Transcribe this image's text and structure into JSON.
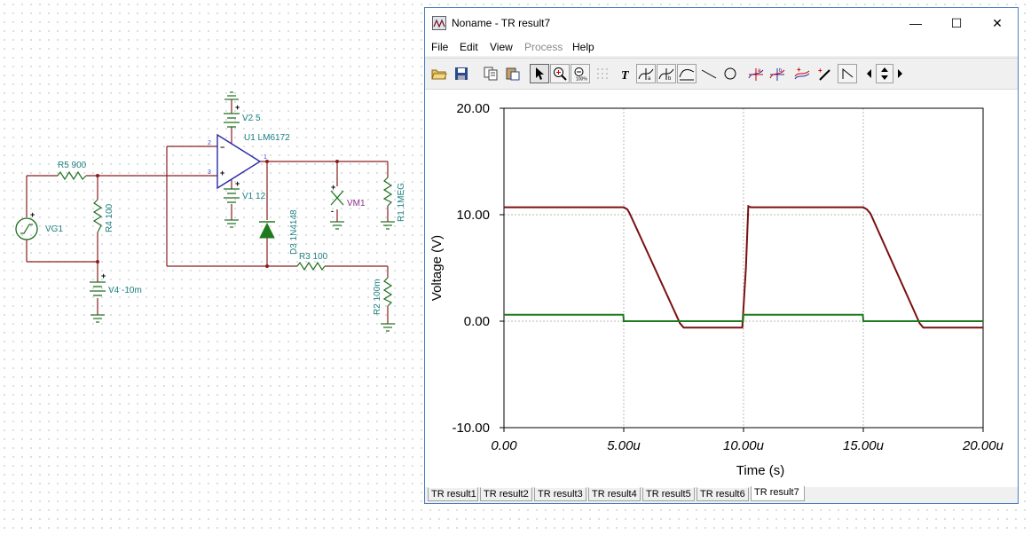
{
  "schematic": {
    "labels": {
      "r5": "R5 900",
      "r4": "R4 100",
      "vg1": "VG1",
      "v4": "V4 -10m",
      "v2": "V2 5",
      "v1": "V1 12",
      "u1": "U1 LM6172",
      "d3": "D3 1N4148",
      "r3": "R3 100",
      "vm1": "VM1",
      "r1": "R1 1MEG",
      "r2": "R2 100m"
    },
    "pins": {
      "p2": "2",
      "p3": "3",
      "p1": "1"
    }
  },
  "window": {
    "title": "Noname - TR result7",
    "controls": {
      "minimize": "—",
      "maximize": "☐",
      "close": "✕"
    },
    "menu": [
      {
        "label": "File",
        "enabled": true
      },
      {
        "label": "Edit",
        "enabled": true
      },
      {
        "label": "View",
        "enabled": true
      },
      {
        "label": "Process",
        "enabled": false
      },
      {
        "label": "Help",
        "enabled": true
      }
    ],
    "toolbar": [
      "open-icon",
      "save-icon",
      "copy-icon",
      "paste-icon",
      "select-arrow-icon",
      "zoom-in-icon",
      "zoom-100-icon",
      "grid-icon",
      "text-tool-icon",
      "cursor-a-icon",
      "cursor-b-icon",
      "curve-icon",
      "line-icon",
      "circle-icon",
      "cursor-cross-a-icon",
      "cursor-cross-b-icon",
      "add-curve-icon",
      "probe-icon",
      "ramp-icon",
      "arrow-left-icon",
      "arrow-updown-icon",
      "arrow-right-icon"
    ],
    "tabs": [
      "TR result1",
      "TR result2",
      "TR result3",
      "TR result4",
      "TR result5",
      "TR result6",
      "TR result7"
    ],
    "active_tab": "TR result7"
  },
  "chart_data": {
    "type": "line",
    "title": "",
    "xlabel": "Time (s)",
    "ylabel": "Voltage (V)",
    "xlim": [
      0,
      20
    ],
    "ylim": [
      -10,
      20
    ],
    "x_ticks": [
      0,
      5,
      10,
      15,
      20
    ],
    "x_tick_labels": [
      "0.00",
      "5.00u",
      "10.00u",
      "15.00u",
      "20.00u"
    ],
    "y_ticks": [
      -10,
      0,
      10,
      20
    ],
    "y_tick_labels": [
      "-10.00",
      "0.00",
      "10.00",
      "20.00"
    ],
    "grid": true,
    "series": [
      {
        "color": "#7a1010",
        "x": [
          0,
          5.0,
          5.15,
          5.25,
          7.35,
          7.5,
          9.95,
          10.1,
          10.2,
          10.3,
          15.0,
          15.15,
          15.3,
          17.35,
          17.5,
          20.0
        ],
        "y": [
          10.7,
          10.7,
          10.5,
          10.1,
          -0.2,
          -0.6,
          -0.6,
          5.0,
          10.8,
          10.7,
          10.7,
          10.5,
          10.1,
          -0.2,
          -0.6,
          -0.6
        ]
      },
      {
        "color": "#1e7a1e",
        "x": [
          0,
          4.98,
          5.0,
          9.98,
          10.0,
          14.98,
          15.0,
          20.0
        ],
        "y": [
          0.6,
          0.6,
          0.0,
          0.0,
          0.6,
          0.6,
          0.0,
          0.0
        ]
      }
    ]
  }
}
